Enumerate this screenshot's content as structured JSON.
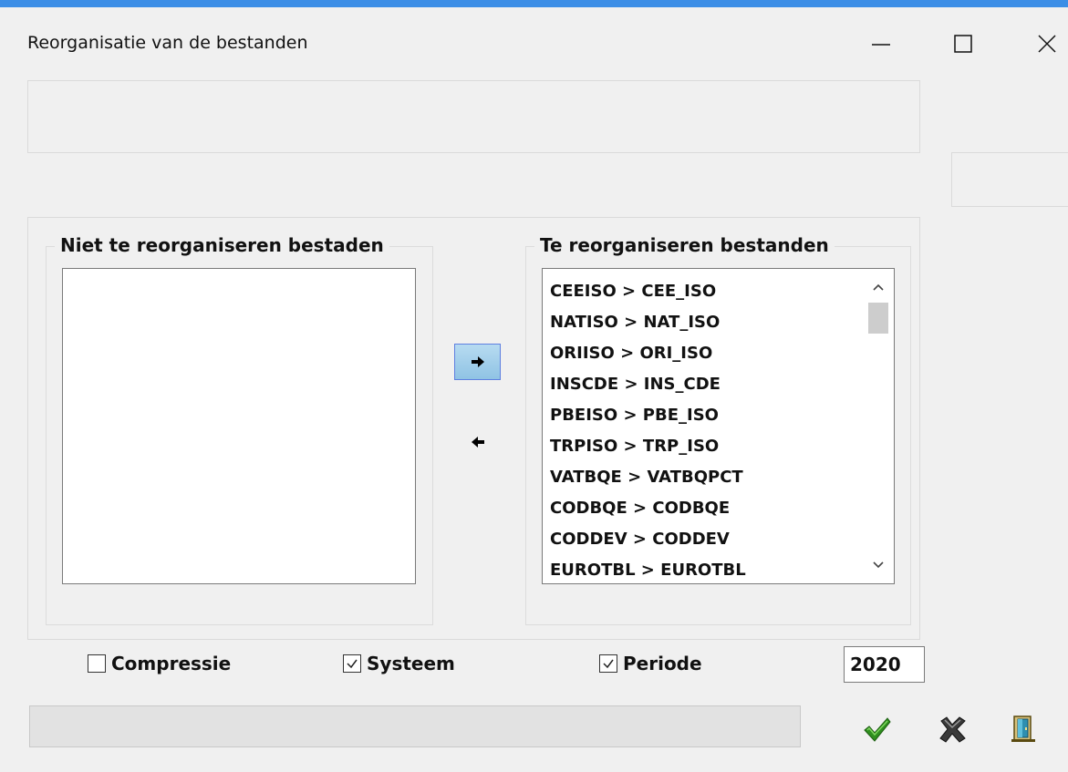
{
  "window": {
    "title": "Reorganisatie van de bestanden",
    "accent_color": "#3c8ee6"
  },
  "groups": {
    "left_title": "Niet te reorganiseren bestaden",
    "right_title": "Te reorganiseren bestanden"
  },
  "left_list": {
    "items": []
  },
  "right_list": {
    "items": [
      "CEEISO > CEE_ISO",
      "NATISO > NAT_ISO",
      "ORIISO > ORI_ISO",
      "INSCDE > INS_CDE",
      "PBEISO > PBE_ISO",
      "TRPISO > TRP_ISO",
      "VATBQE > VATBQPCT",
      "CODBQE > CODBQE",
      "CODDEV > CODDEV",
      "EUROTBL > EUROTBL"
    ]
  },
  "options": {
    "compressie": {
      "label": "Compressie",
      "checked": false
    },
    "systeem": {
      "label": "Systeem",
      "checked": true
    },
    "periode": {
      "label": "Periode",
      "checked": true
    },
    "year": "2020"
  },
  "icons": {
    "move_right": "arrow-right-icon",
    "move_left": "arrow-left-icon",
    "ok": "checkmark-icon",
    "cancel": "x-cancel-icon",
    "exit": "exit-door-icon"
  }
}
